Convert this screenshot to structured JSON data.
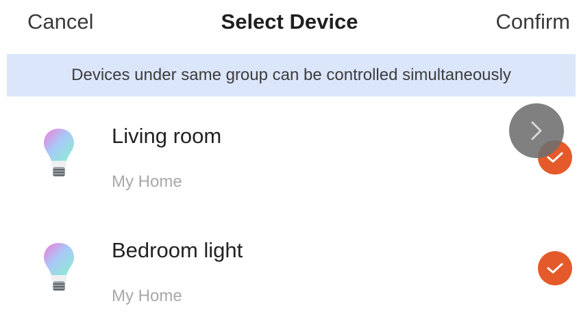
{
  "header": {
    "cancel_label": "Cancel",
    "title": "Select Device",
    "confirm_label": "Confirm"
  },
  "banner": {
    "text": "Devices under same group can be controlled simultaneously"
  },
  "devices": [
    {
      "name": "Living room",
      "location": "My Home",
      "selected": true,
      "icon": "smart-bulb-icon"
    },
    {
      "name": "Bedroom light",
      "location": "My Home",
      "selected": true,
      "icon": "smart-bulb-icon"
    }
  ],
  "floating_button": {
    "icon": "chevron-right-icon"
  },
  "colors": {
    "accent": "#e55a2a",
    "banner_bg": "#dbe6fb",
    "floating_button": "#6e6e6e"
  }
}
